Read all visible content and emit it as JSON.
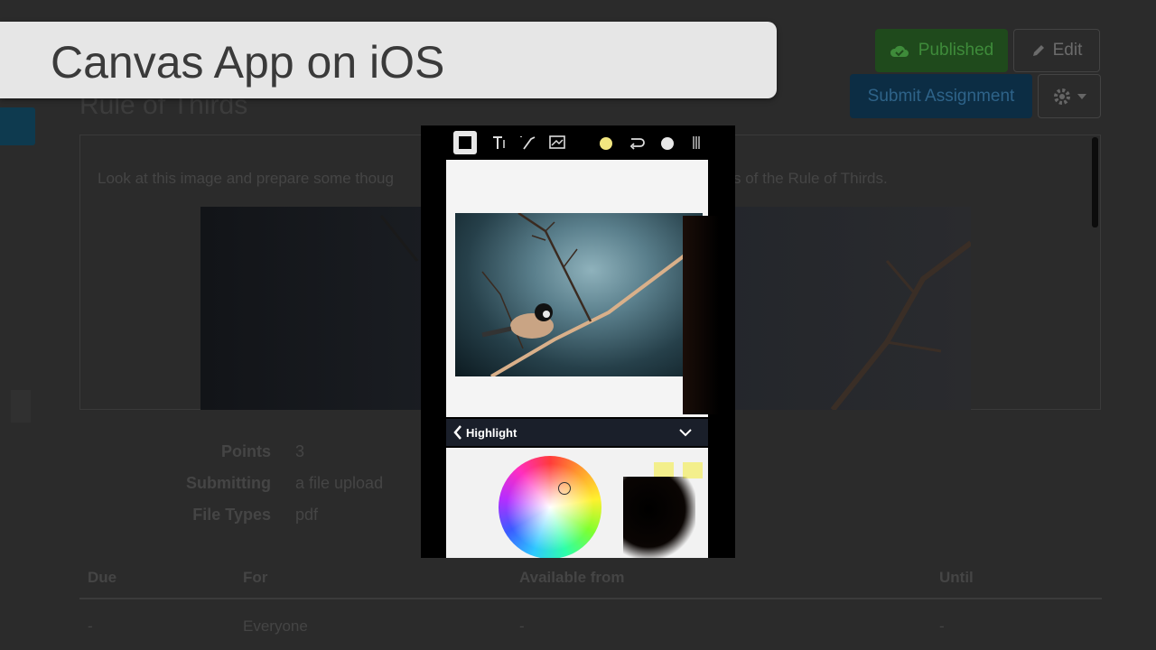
{
  "banner": {
    "title": "Canvas App on iOS"
  },
  "header": {
    "page_title": "Rule of Thirds",
    "published_label": "Published",
    "edit_label": "Edit",
    "submit_label": "Submit Assignment"
  },
  "description": {
    "text_left": "Look at this image and prepare some thoug",
    "text_right": "s of the Rule of Thirds."
  },
  "details": {
    "points_label": "Points",
    "points_value": "3",
    "submitting_label": "Submitting",
    "submitting_value": "a file upload",
    "file_types_label": "File Types",
    "file_types_value": "pdf"
  },
  "table": {
    "headers": [
      "Due",
      "For",
      "Available from",
      "Until"
    ],
    "row": [
      "-",
      "Everyone",
      "-",
      "-"
    ]
  },
  "phone": {
    "highlight_label": "Highlight"
  },
  "colors": {
    "published_bg": "#1f4a1c",
    "submit_bg": "#0c2d44",
    "highlight_swatch": "#f3ef8c"
  },
  "icons": [
    "cloud-check-icon",
    "pencil-icon",
    "gear-icon",
    "caret-down-icon",
    "rectangle-icon",
    "text-icon",
    "ink-icon",
    "image-icon",
    "color-dot-icon",
    "undo-icon",
    "chevron-left-icon",
    "chevron-down-icon"
  ]
}
